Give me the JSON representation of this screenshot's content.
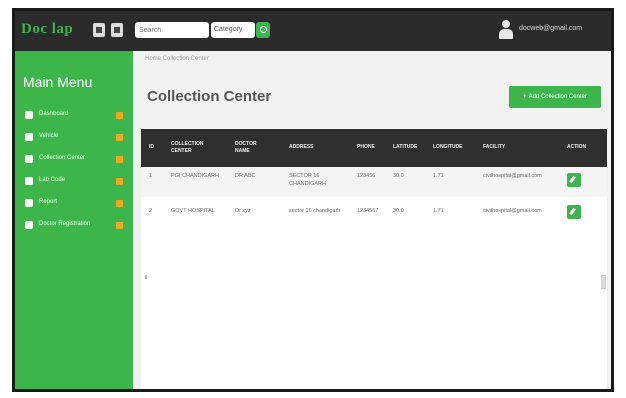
{
  "app": {
    "logo_text": "Doc lap",
    "accent_color": "#3cb54a",
    "topbar_color": "#2b2b2b"
  },
  "search": {
    "placeholder": "Search",
    "select_value": "Category"
  },
  "user": {
    "email": "docweb@gmail.com"
  },
  "sidebar": {
    "title": "Main Menu",
    "items": [
      {
        "label": "Dashboard",
        "icon": "home-icon"
      },
      {
        "label": "Vehicle",
        "icon": "car-icon"
      },
      {
        "label": "Collection Center",
        "icon": "pin-icon"
      },
      {
        "label": "Lab Code",
        "icon": "flask-icon"
      },
      {
        "label": "Report",
        "icon": "chart-icon"
      },
      {
        "label": "Doctor Registration",
        "icon": "user-plus-icon"
      }
    ]
  },
  "breadcrumb": "Home  Collection Center",
  "page": {
    "title": "Collection Center",
    "add_button": "Add Collection Center"
  },
  "table": {
    "headers": [
      "ID",
      "COLLECTION CENTER",
      "DOCTOR NAME",
      "ADDRESS",
      "PHONE",
      "LATITUDE",
      "LONGITUDE",
      "FACILITY",
      "ACTION"
    ],
    "rows": [
      {
        "id": "1",
        "center": "PGI CHANDIGARH",
        "doctor": "DR ABC",
        "address": "SECTOR 16 CHANDIGARH",
        "phone": "123456",
        "latitude": "30.0",
        "longitude": "1.71",
        "facility": "civilhospital@gmail.com"
      },
      {
        "id": "2",
        "center": "GOVT HOSPITAL",
        "doctor": "Dr xyz",
        "address": "sector 16 chandigarh",
        "phone": "1234567",
        "latitude": "30.0",
        "longitude": "1.71",
        "facility": "civilhospital@gmail.com"
      }
    ]
  }
}
